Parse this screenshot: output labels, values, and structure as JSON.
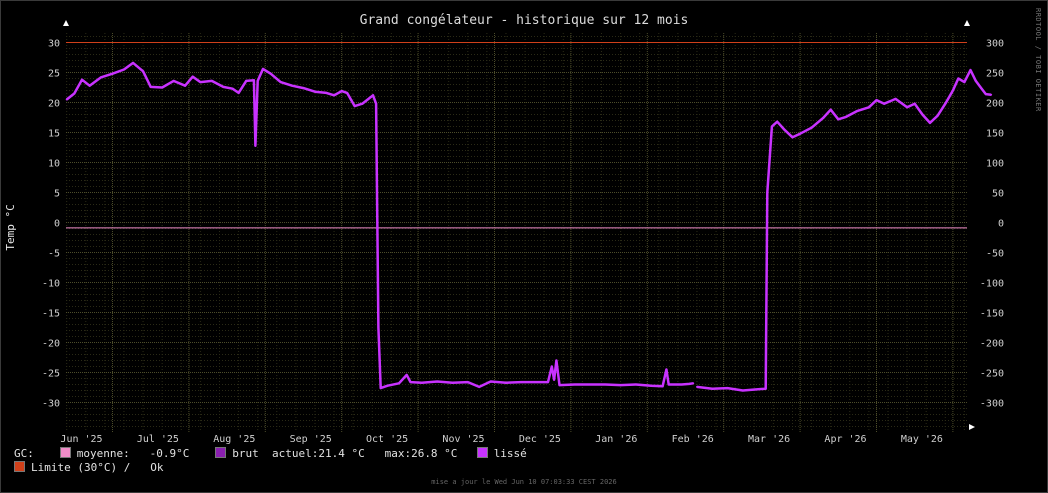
{
  "chart_data": {
    "type": "line",
    "title": "Grand congélateur - historique sur 12 mois",
    "ylabel": "Temp °C",
    "ylim": [
      -35,
      33
    ],
    "y_ticks": [
      30,
      25,
      20,
      15,
      10,
      5,
      0,
      -5,
      -10,
      -15,
      -20,
      -25,
      -30
    ],
    "y_ticks_right": [
      "300",
      "250",
      "200",
      "150",
      "100",
      "50",
      "0",
      "-50",
      "-100",
      "-150",
      "-200",
      "-250",
      "-300"
    ],
    "x_ticks": [
      "Jun '25",
      "Jul '25",
      "Aug '25",
      "Sep '25",
      "Oct '25",
      "Nov '25",
      "Dec '25",
      "Jan '26",
      "Feb '26",
      "Mar '26",
      "Apr '26",
      "May '26"
    ],
    "x_month_start": [
      0,
      1,
      2,
      3,
      4,
      5,
      6,
      7,
      8,
      9,
      10,
      11
    ],
    "xlim": [
      -0.05,
      11.75
    ],
    "limit_value": 30,
    "mean_value": -0.9,
    "series": [
      {
        "name": "lissé",
        "color": "#c832ff",
        "points": [
          [
            -0.05,
            20.5
          ],
          [
            0.05,
            21.5
          ],
          [
            0.15,
            23.8
          ],
          [
            0.25,
            22.8
          ],
          [
            0.4,
            24.2
          ],
          [
            0.55,
            24.8
          ],
          [
            0.7,
            25.5
          ],
          [
            0.82,
            26.6
          ],
          [
            0.95,
            25.2
          ],
          [
            1.05,
            22.6
          ],
          [
            1.2,
            22.5
          ],
          [
            1.35,
            23.6
          ],
          [
            1.5,
            22.8
          ],
          [
            1.6,
            24.3
          ],
          [
            1.7,
            23.4
          ],
          [
            1.85,
            23.6
          ],
          [
            2.0,
            22.6
          ],
          [
            2.12,
            22.3
          ],
          [
            2.2,
            21.6
          ],
          [
            2.3,
            23.6
          ],
          [
            2.4,
            23.7
          ],
          [
            2.42,
            12.8
          ],
          [
            2.45,
            23.6
          ],
          [
            2.52,
            25.6
          ],
          [
            2.62,
            24.8
          ],
          [
            2.75,
            23.4
          ],
          [
            2.9,
            22.8
          ],
          [
            3.05,
            22.4
          ],
          [
            3.2,
            21.8
          ],
          [
            3.35,
            21.6
          ],
          [
            3.45,
            21.2
          ],
          [
            3.55,
            21.9
          ],
          [
            3.62,
            21.6
          ],
          [
            3.72,
            19.4
          ],
          [
            3.82,
            19.8
          ],
          [
            3.9,
            20.6
          ],
          [
            3.96,
            21.2
          ],
          [
            4.0,
            19.8
          ],
          [
            4.03,
            -17.5
          ],
          [
            4.06,
            -27.6
          ],
          [
            4.15,
            -27.2
          ],
          [
            4.3,
            -26.8
          ],
          [
            4.4,
            -25.4
          ],
          [
            4.45,
            -26.6
          ],
          [
            4.6,
            -26.7
          ],
          [
            4.8,
            -26.5
          ],
          [
            5.0,
            -26.7
          ],
          [
            5.2,
            -26.6
          ],
          [
            5.35,
            -27.4
          ],
          [
            5.5,
            -26.5
          ],
          [
            5.7,
            -26.7
          ],
          [
            5.9,
            -26.6
          ],
          [
            6.1,
            -26.6
          ],
          [
            6.25,
            -26.6
          ],
          [
            6.3,
            -24.0
          ],
          [
            6.33,
            -26.2
          ],
          [
            6.36,
            -23.0
          ],
          [
            6.4,
            -27.1
          ],
          [
            6.6,
            -27.0
          ],
          [
            6.8,
            -27.0
          ],
          [
            7.0,
            -27.0
          ],
          [
            7.2,
            -27.1
          ],
          [
            7.4,
            -27.0
          ],
          [
            7.6,
            -27.2
          ],
          [
            7.75,
            -27.3
          ],
          [
            7.8,
            -24.5
          ],
          [
            7.83,
            -27.0
          ],
          [
            8.0,
            -27.0
          ],
          [
            8.1,
            -26.9
          ],
          [
            8.15,
            -26.8
          ]
        ]
      },
      {
        "name": "lissé",
        "color": "#c832ff",
        "points": [
          [
            8.2,
            -27.4
          ],
          [
            8.4,
            -27.7
          ],
          [
            8.6,
            -27.6
          ],
          [
            8.8,
            -28.0
          ],
          [
            9.0,
            -27.8
          ],
          [
            9.1,
            -27.7
          ],
          [
            9.12,
            5.0
          ],
          [
            9.18,
            16.0
          ],
          [
            9.25,
            16.8
          ],
          [
            9.35,
            15.4
          ],
          [
            9.45,
            14.2
          ],
          [
            9.55,
            14.8
          ],
          [
            9.7,
            15.8
          ],
          [
            9.85,
            17.4
          ],
          [
            9.95,
            18.8
          ],
          [
            10.05,
            17.2
          ],
          [
            10.15,
            17.6
          ],
          [
            10.3,
            18.6
          ],
          [
            10.45,
            19.2
          ],
          [
            10.55,
            20.4
          ],
          [
            10.65,
            19.8
          ],
          [
            10.8,
            20.6
          ],
          [
            10.95,
            19.2
          ],
          [
            11.05,
            19.8
          ],
          [
            11.15,
            18.0
          ],
          [
            11.25,
            16.6
          ],
          [
            11.35,
            17.8
          ],
          [
            11.45,
            19.8
          ],
          [
            11.55,
            22.0
          ],
          [
            11.62,
            24.0
          ],
          [
            11.7,
            23.4
          ],
          [
            11.78,
            25.4
          ],
          [
            11.85,
            23.6
          ],
          [
            11.92,
            22.4
          ],
          [
            11.98,
            21.4
          ],
          [
            12.05,
            21.3
          ]
        ]
      }
    ],
    "legend": {
      "prefix": "GC:",
      "mean_label": "moyenne:",
      "mean_text": "-0.9°C",
      "mean_color": "#f08cc8",
      "raw_label": "brut",
      "raw_color": "#8a1fb0",
      "current_text": "actuel:21.4 °C",
      "max_text": "max:26.8 °C",
      "smooth_label": "lissé",
      "smooth_color": "#c832ff",
      "limit_label": "Limite (30°C) /",
      "limit_status": "Ok",
      "limit_color": "#d0401a"
    }
  },
  "vertical_text": "RRDTOOL / TOBI OETIKER",
  "footer": "mise a jour le Wed Jun 10 07:03:33 CEST 2026"
}
